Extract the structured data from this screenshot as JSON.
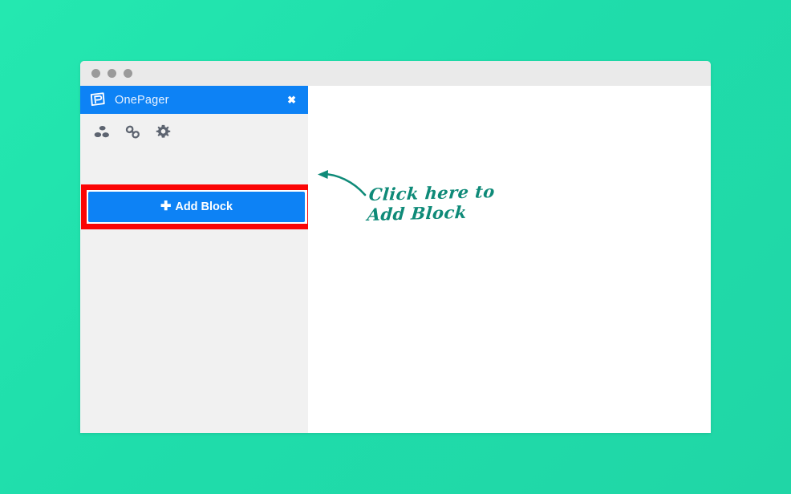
{
  "background": {
    "color_from": "#24e8b0",
    "color_to": "#20d6a6"
  },
  "window": {
    "title_bar": {
      "dots": [
        {
          "name": "traffic-light-close",
          "color": "#9a9a9a"
        },
        {
          "name": "traffic-light-minimize",
          "color": "#9a9a9a"
        },
        {
          "name": "traffic-light-maximize",
          "color": "#9a9a9a"
        }
      ]
    }
  },
  "panel": {
    "logo_icon": "onepager-logo-icon",
    "title": "OnePager",
    "close_label": "✖",
    "header_color": "#0d82f5",
    "toolbar": [
      {
        "icon": "blocks-icon",
        "name": "blocks"
      },
      {
        "icon": "link-icon",
        "name": "link"
      },
      {
        "icon": "gear-icon",
        "name": "settings"
      }
    ],
    "add_block": {
      "plus": "✚",
      "label": "Add Block",
      "button_color": "#0d82f5",
      "highlight_color": "#fb0505"
    }
  },
  "annotation": {
    "text": "Click here to\nAdd Block",
    "color": "#0e8a78",
    "arrow_icon": "curved-arrow-left-icon"
  }
}
